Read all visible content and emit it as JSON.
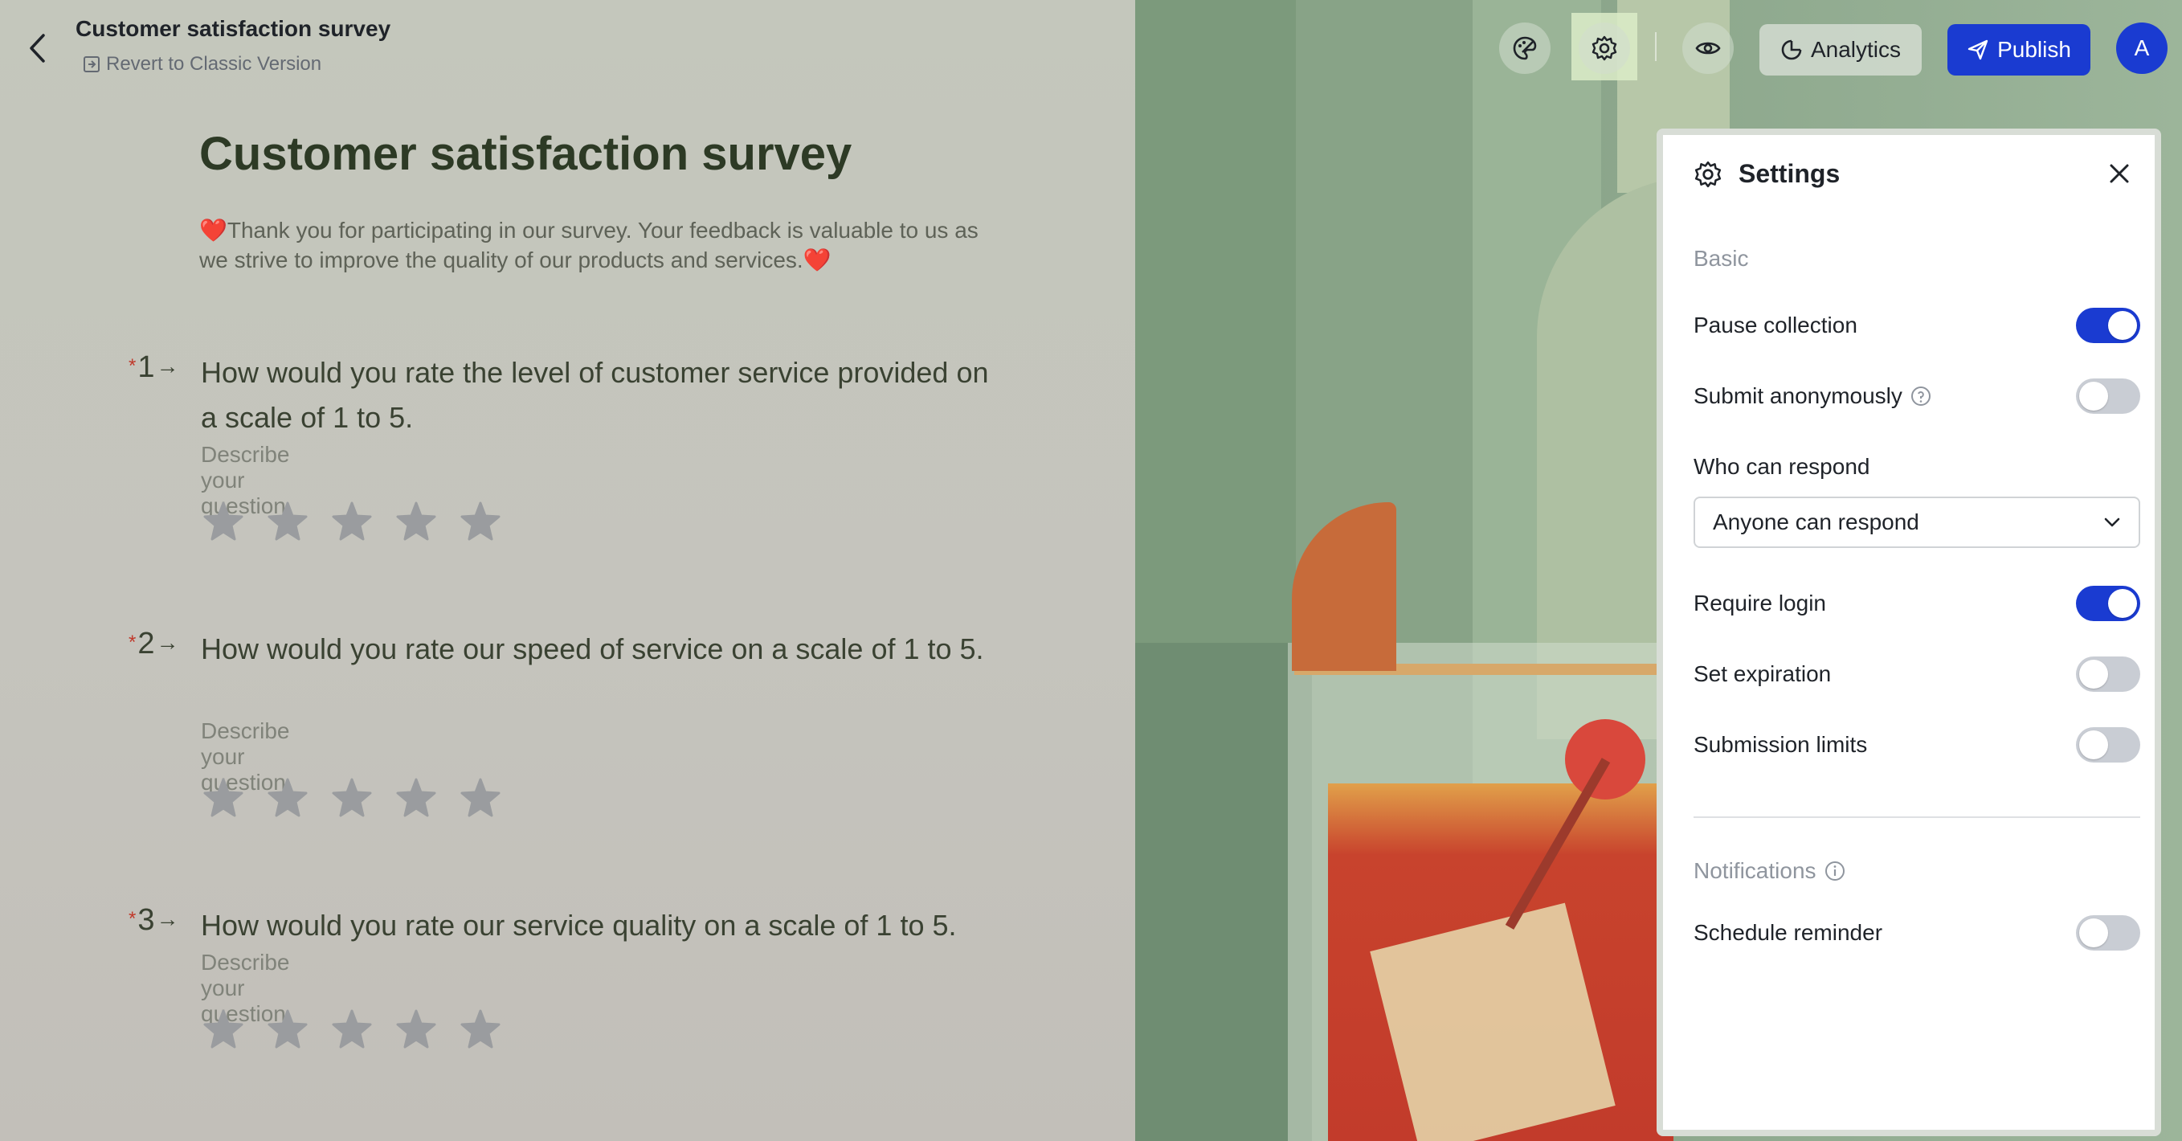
{
  "header": {
    "doc_title": "Customer satisfaction survey",
    "revert_label": "Revert to Classic Version",
    "analytics_label": "Analytics",
    "publish_label": "Publish",
    "avatar_initial": "A"
  },
  "survey": {
    "title": "Customer satisfaction survey",
    "description": "❤️Thank you for participating in our survey. Your feedback is valuable to us as we strive to improve the quality of our products and services.❤️",
    "questions": [
      {
        "number": "1",
        "required_mark": "*",
        "text": "How would you rate the level of customer service provided on a scale of 1 to 5.",
        "hint": "Describe your question",
        "stars": 5
      },
      {
        "number": "2",
        "required_mark": "*",
        "text": "How would you rate our speed of service on a scale of 1 to 5.",
        "hint": "Describe your question",
        "stars": 5
      },
      {
        "number": "3",
        "required_mark": "*",
        "text": "How would you rate our service quality on a scale of 1 to 5.",
        "hint": "Describe your question",
        "stars": 5
      }
    ]
  },
  "settings": {
    "title": "Settings",
    "basic_label": "Basic",
    "pause_collection": {
      "label": "Pause collection",
      "on": true
    },
    "submit_anonymously": {
      "label": "Submit anonymously",
      "on": false
    },
    "who_can_respond_label": "Who can respond",
    "who_can_respond_value": "Anyone can respond",
    "require_login": {
      "label": "Require login",
      "on": true
    },
    "set_expiration": {
      "label": "Set expiration",
      "on": false
    },
    "submission_limits": {
      "label": "Submission limits",
      "on": false
    },
    "notifications_label": "Notifications",
    "schedule_reminder": {
      "label": "Schedule reminder",
      "on": false
    }
  },
  "colors": {
    "accent": "#1a3bd1",
    "toggle_off": "#c9cdd4",
    "required": "#c0392b"
  },
  "icons": {
    "back": "chevron-left-icon",
    "revert": "exit-icon",
    "theme": "palette-icon",
    "settings": "gear-icon",
    "preview": "eye-icon",
    "analytics": "chart-circle-icon",
    "publish": "send-icon",
    "close": "close-icon",
    "help": "question-icon",
    "info": "info-icon",
    "dropdown": "chevron-down-icon",
    "star": "star-icon"
  }
}
